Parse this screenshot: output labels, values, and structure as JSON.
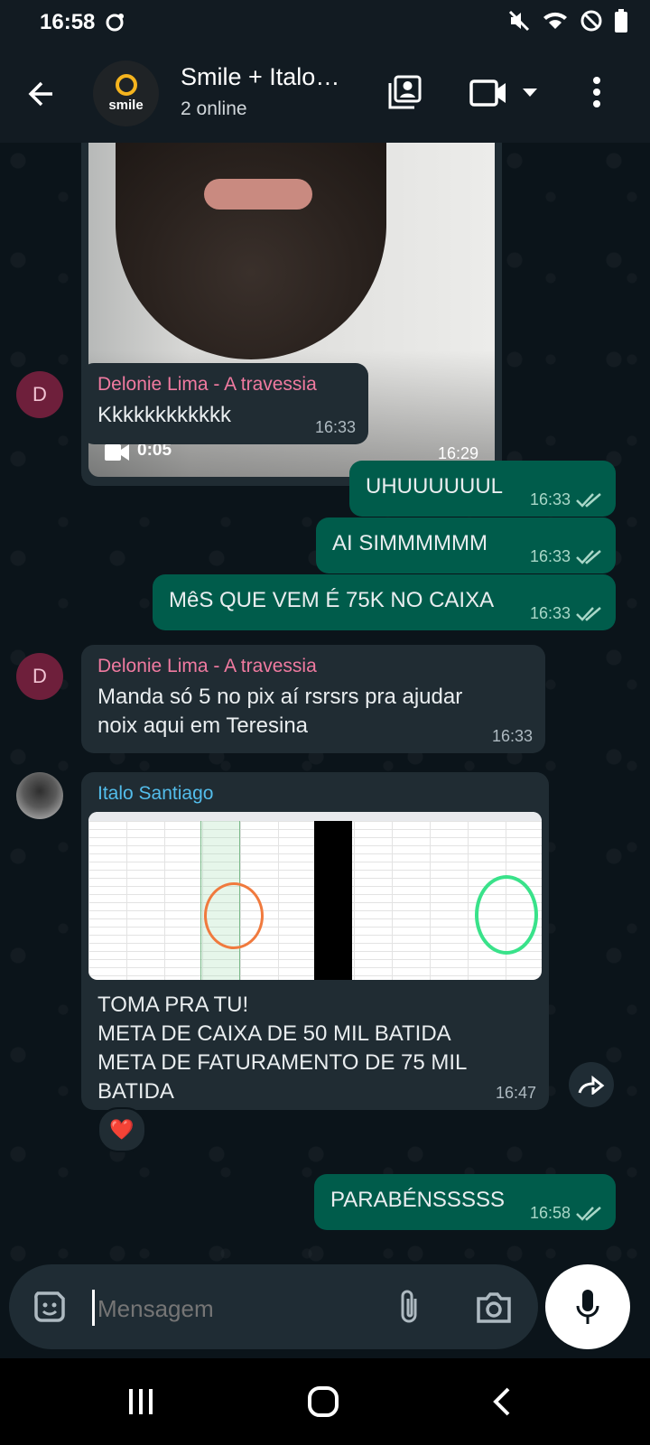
{
  "status": {
    "time": "16:58"
  },
  "header": {
    "avatar_text": "smile",
    "title": "Smile + Italo…",
    "subtitle": "2 online"
  },
  "messages": {
    "video": {
      "duration": "0:05",
      "time": "16:29"
    },
    "m1": {
      "sender": "Delonie Lima - A travessia",
      "initial": "D",
      "text": "Kkkkkkkkkkkk",
      "time": "16:33"
    },
    "m2": {
      "text": "UHUUUUUUL",
      "time": "16:33"
    },
    "m3": {
      "text": "AI SIMMMMMM",
      "time": "16:33"
    },
    "m4": {
      "text": "MêS QUE VEM É 75K NO CAIXA",
      "time": "16:33"
    },
    "m5": {
      "sender": "Delonie Lima - A travessia",
      "initial": "D",
      "line1": "Manda só 5 no pix aí rsrsrs pra ajudar",
      "line2": "noix aqui em Teresina",
      "time": "16:33"
    },
    "m6": {
      "sender": "Italo Santiago",
      "line1": "TOMA PRA TU!",
      "line2": "META DE CAIXA DE 50 MIL BATIDA",
      "line3": "META DE FATURAMENTO DE 75 MIL",
      "line4": "BATIDA",
      "time": "16:47",
      "reaction": "❤️"
    },
    "m7": {
      "text": "PARABÉNSSSSS",
      "time": "16:58"
    }
  },
  "input": {
    "placeholder": "Mensagem"
  },
  "colors": {
    "incoming_bubble": "#202c33",
    "outgoing_bubble": "#005c4b",
    "sender_pink": "#f07aa0",
    "sender_blue": "#53bdeb",
    "read_tick": "#a9d7c8"
  }
}
